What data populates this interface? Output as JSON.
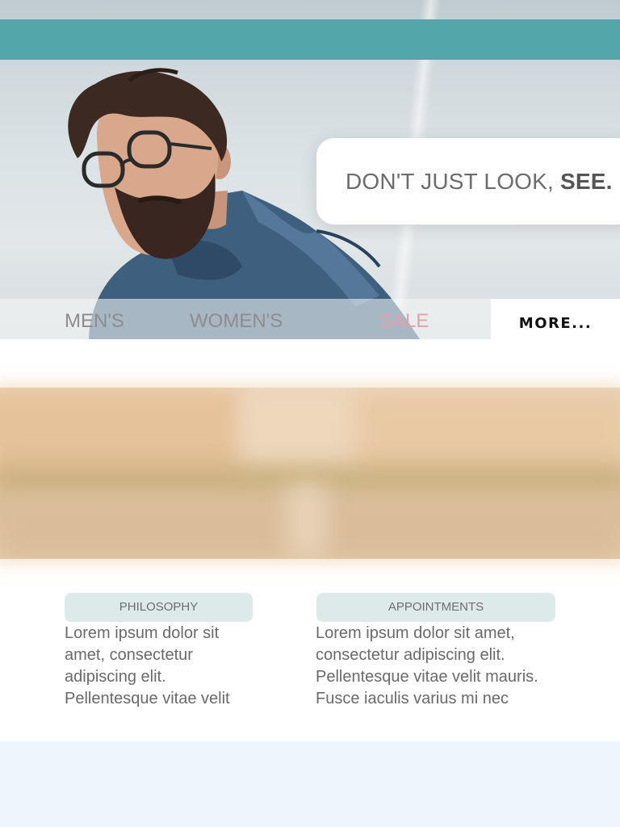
{
  "hero": {
    "tagline_main": "DON'T JUST LOOK,",
    "tagline_emphasis": "SEE."
  },
  "nav": {
    "items": [
      {
        "label": "MEN'S"
      },
      {
        "label": "WOMEN'S"
      },
      {
        "label": "SALE"
      }
    ],
    "more_label": "MORE..."
  },
  "sections": [
    {
      "title": "PHILOSOPHY",
      "text": "Lorem ipsum dolor sit amet, consectetur adipiscing elit. Pellentesque vitae velit"
    },
    {
      "title": "APPOINTMENTS",
      "text": "Lorem ipsum dolor sit amet, consectetur adipiscing elit. Pellentesque vitae velit mauris. Fusce iaculis varius mi nec"
    }
  ],
  "colors": {
    "topbar": "#53a6a9",
    "pill_bg": "#deeaea",
    "sale_text": "#e0a2a8",
    "footer_bg": "#eef6fb"
  }
}
